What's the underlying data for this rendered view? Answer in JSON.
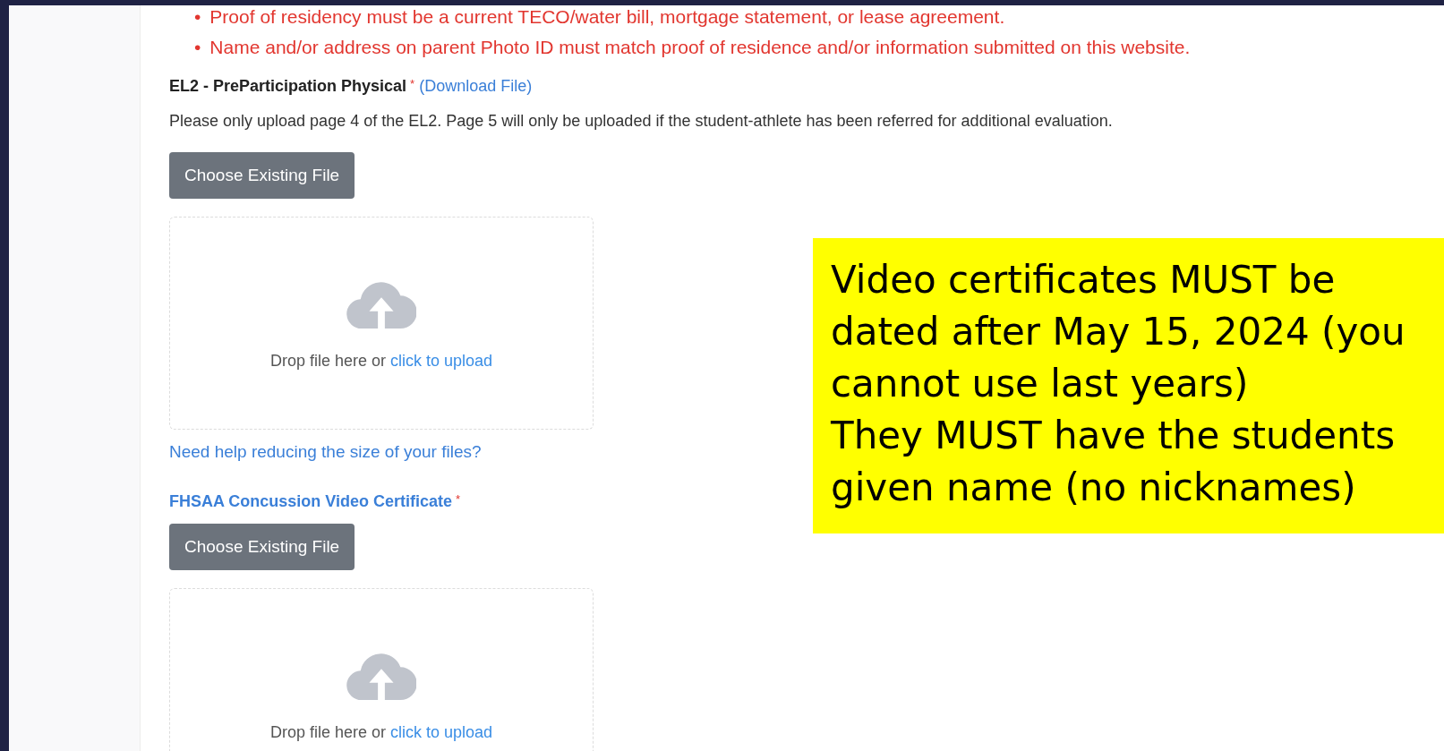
{
  "notices": [
    {
      "bullet": "•",
      "text": "Proof of residency must be a current TECO/water bill, mortgage statement, or lease agreement."
    },
    {
      "bullet": "•",
      "text": "Name and/or address on parent Photo ID must match proof of residence and/or information submitted on this website."
    }
  ],
  "fields": [
    {
      "kind": "plain",
      "label": "EL2 - PreParticipation Physical",
      "required_mark": "*",
      "label_link": "(Download File)",
      "description": "Please only upload page 4 of the EL2. Page 5 will only be uploaded if the student-athlete has been referred for additional evaluation.",
      "button": "Choose Existing File",
      "drop_text": "Drop file here or",
      "drop_link": "click to upload",
      "help_link": "Need help reducing the size of your files?"
    },
    {
      "kind": "link",
      "label": "FHSAA Concussion Video Certificate",
      "required_mark": "*",
      "button": "Choose Existing File",
      "drop_text": "Drop file here or",
      "drop_link": "click to upload"
    }
  ],
  "callout": [
    "Video certificates MUST be dated after May 15, 2024 (you cannot use last years)",
    "They MUST have the students given name (no nicknames)"
  ]
}
